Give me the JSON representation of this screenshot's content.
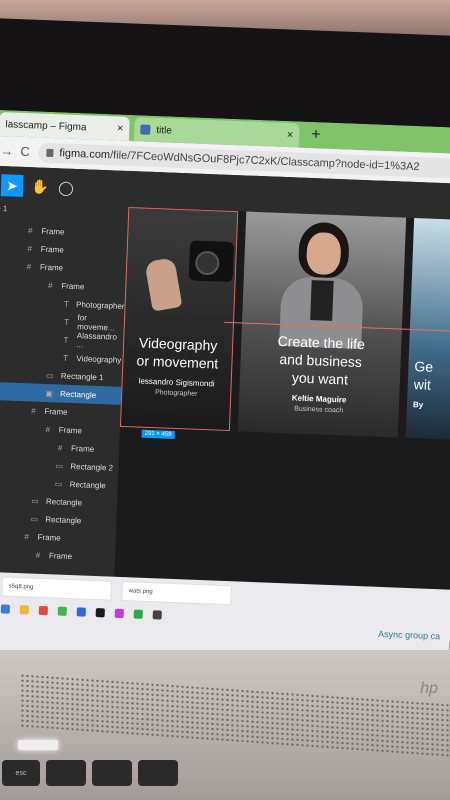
{
  "browser": {
    "tabs": [
      {
        "label": "lasscamp – Figma",
        "close": "×"
      },
      {
        "label": "title",
        "close": "×"
      }
    ],
    "new_tab": "+",
    "nav": {
      "forward": "→",
      "reload": "C"
    },
    "url": {
      "host": "figma.com",
      "path": "/file/7FCeoWdNsGOuF8Pjc7C2xK/Classcamp?node-id=1%3A2"
    }
  },
  "toolbar": {
    "page_prefix": "e 1"
  },
  "layers": [
    {
      "icon": "#",
      "label": "Frame"
    },
    {
      "icon": "#",
      "label": "Frame"
    },
    {
      "icon": "#",
      "label": "Frame"
    },
    {
      "icon": "#",
      "label": "Frame"
    },
    {
      "icon": "T",
      "label": "Photographer"
    },
    {
      "icon": "T",
      "label": "for moveme..."
    },
    {
      "icon": "T",
      "label": "Alassandro ..."
    },
    {
      "icon": "T",
      "label": "Videography"
    },
    {
      "icon": "▭",
      "label": "Rectangle 1"
    },
    {
      "icon": "▣",
      "label": "Rectangle"
    },
    {
      "icon": "#",
      "label": "Frame"
    },
    {
      "icon": "#",
      "label": "Frame"
    },
    {
      "icon": "#",
      "label": "Frame"
    },
    {
      "icon": "▭",
      "label": "Rectangle 2"
    },
    {
      "icon": "▭",
      "label": "Rectangle"
    },
    {
      "icon": "▭",
      "label": "Rectangle"
    },
    {
      "icon": "▭",
      "label": "Rectangle"
    },
    {
      "icon": "#",
      "label": "Frame"
    },
    {
      "icon": "#",
      "label": "Frame"
    }
  ],
  "cards": [
    {
      "title_l1": "Videography",
      "title_l2": "or movement",
      "name": "lessandro Sigismondi",
      "role": "Photographer"
    },
    {
      "title_l1": "Create the life",
      "title_l2": "and business",
      "title_l3": "you want",
      "name": "Keltie Maguire",
      "role": "Business coach"
    },
    {
      "title_l1": "Ge",
      "title_l2": "wit",
      "name": "By"
    }
  ],
  "selection_size": "291 × 458",
  "taskbar": {
    "downloads": [
      {
        "label": "s5q8.png"
      },
      {
        "label": "wats.png"
      }
    ],
    "notification": "Async group ca"
  },
  "device": {
    "brand": "hp",
    "key_esc": "esc"
  },
  "colors": {
    "accent": "#0d99ff",
    "guide": "#e26f5a",
    "tabbar": "#7fc46a"
  }
}
